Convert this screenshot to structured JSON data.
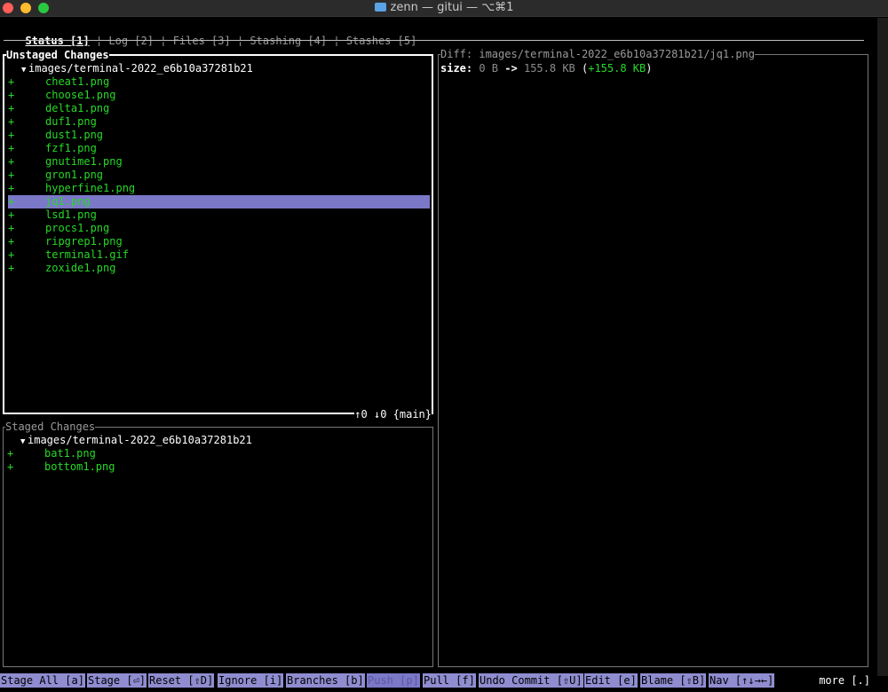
{
  "window": {
    "title": "zenn — gitui — ⌥⌘1"
  },
  "tabs": [
    {
      "label": "Status [1]",
      "active": true
    },
    {
      "label": "Log [2]"
    },
    {
      "label": "Files [3]"
    },
    {
      "label": "Stashing [4]"
    },
    {
      "label": "Stashes [5]"
    }
  ],
  "tab_separator": "¦",
  "unstaged": {
    "title": "Unstaged Changes",
    "directory": "images/terminal-2022_e6b10a37281b21",
    "caret": "▼",
    "files": [
      {
        "status": "+",
        "name": "cheat1.png"
      },
      {
        "status": "+",
        "name": "choose1.png"
      },
      {
        "status": "+",
        "name": "delta1.png"
      },
      {
        "status": "+",
        "name": "duf1.png"
      },
      {
        "status": "+",
        "name": "dust1.png"
      },
      {
        "status": "+",
        "name": "fzf1.png"
      },
      {
        "status": "+",
        "name": "gnutime1.png"
      },
      {
        "status": "+",
        "name": "gron1.png"
      },
      {
        "status": "+",
        "name": "hyperfine1.png"
      },
      {
        "status": "+",
        "name": "jq1.png",
        "selected": true
      },
      {
        "status": "+",
        "name": "lsd1.png"
      },
      {
        "status": "+",
        "name": "procs1.png"
      },
      {
        "status": "+",
        "name": "ripgrep1.png"
      },
      {
        "status": "+",
        "name": "terminal1.gif"
      },
      {
        "status": "+",
        "name": "zoxide1.png"
      }
    ],
    "branch_info": "↑0 ↓0 {main}"
  },
  "staged": {
    "title": "Staged Changes",
    "directory": "images/terminal-2022_e6b10a37281b21",
    "caret": "▼",
    "files": [
      {
        "status": "+",
        "name": "bat1.png"
      },
      {
        "status": "+",
        "name": "bottom1.png"
      }
    ]
  },
  "diff": {
    "title": "Diff: images/terminal-2022_e6b10a37281b21/jq1.png",
    "size_label": "size:",
    "old_size": "0 B",
    "arrow": "->",
    "new_size": "155.8 KB",
    "delta_open": "(",
    "delta": "+155.8 KB",
    "delta_close": ")"
  },
  "commands": [
    {
      "label": "Stage All [a]"
    },
    {
      "label": "Stage [⏎]"
    },
    {
      "label": "Reset [⇧D]"
    },
    {
      "label": "Ignore [i]"
    },
    {
      "label": "Branches [b]"
    },
    {
      "label": "Push [p]",
      "disabled": true
    },
    {
      "label": "Pull [f]"
    },
    {
      "label": "Undo Commit [⇧U]"
    },
    {
      "label": "Edit [e]"
    },
    {
      "label": "Blame [⇧B]"
    },
    {
      "label": "Nav [↑↓→←]"
    }
  ],
  "more": "more [.]",
  "colors": {
    "added": "#27d927",
    "selection": "#7b78c8",
    "command_bg": "#8f8dd0"
  }
}
